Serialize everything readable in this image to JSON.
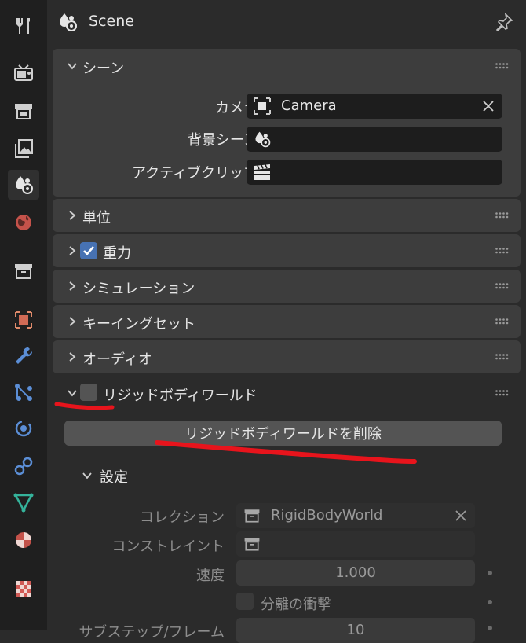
{
  "header": {
    "title": "Scene"
  },
  "panels": {
    "scene": {
      "title": "シーン",
      "camera_label": "カメラ",
      "camera_value": "Camera",
      "bg_label": "背景シーン",
      "clip_label": "アクティブクリップ"
    },
    "units": {
      "title": "単位"
    },
    "gravity": {
      "title": "重力",
      "checked": true
    },
    "simulation": {
      "title": "シミュレーション"
    },
    "keying": {
      "title": "キーイングセット"
    },
    "audio": {
      "title": "オーディオ"
    },
    "rigidbody": {
      "title": "リジッドボディワールド",
      "remove_button": "リジッドボディワールドを削除",
      "settings_title": "設定",
      "collection_label": "コレクション",
      "collection_value": "RigidBodyWorld",
      "constraints_label": "コンストレイント",
      "speed_label": "速度",
      "speed_value": "1.000",
      "split_impulse_label": "分離の衝撃",
      "substeps_label": "サブステップ/フレーム",
      "substeps_value": "10"
    }
  },
  "colors": {
    "accent": "#4772b3",
    "annotation": "#e8141c"
  }
}
